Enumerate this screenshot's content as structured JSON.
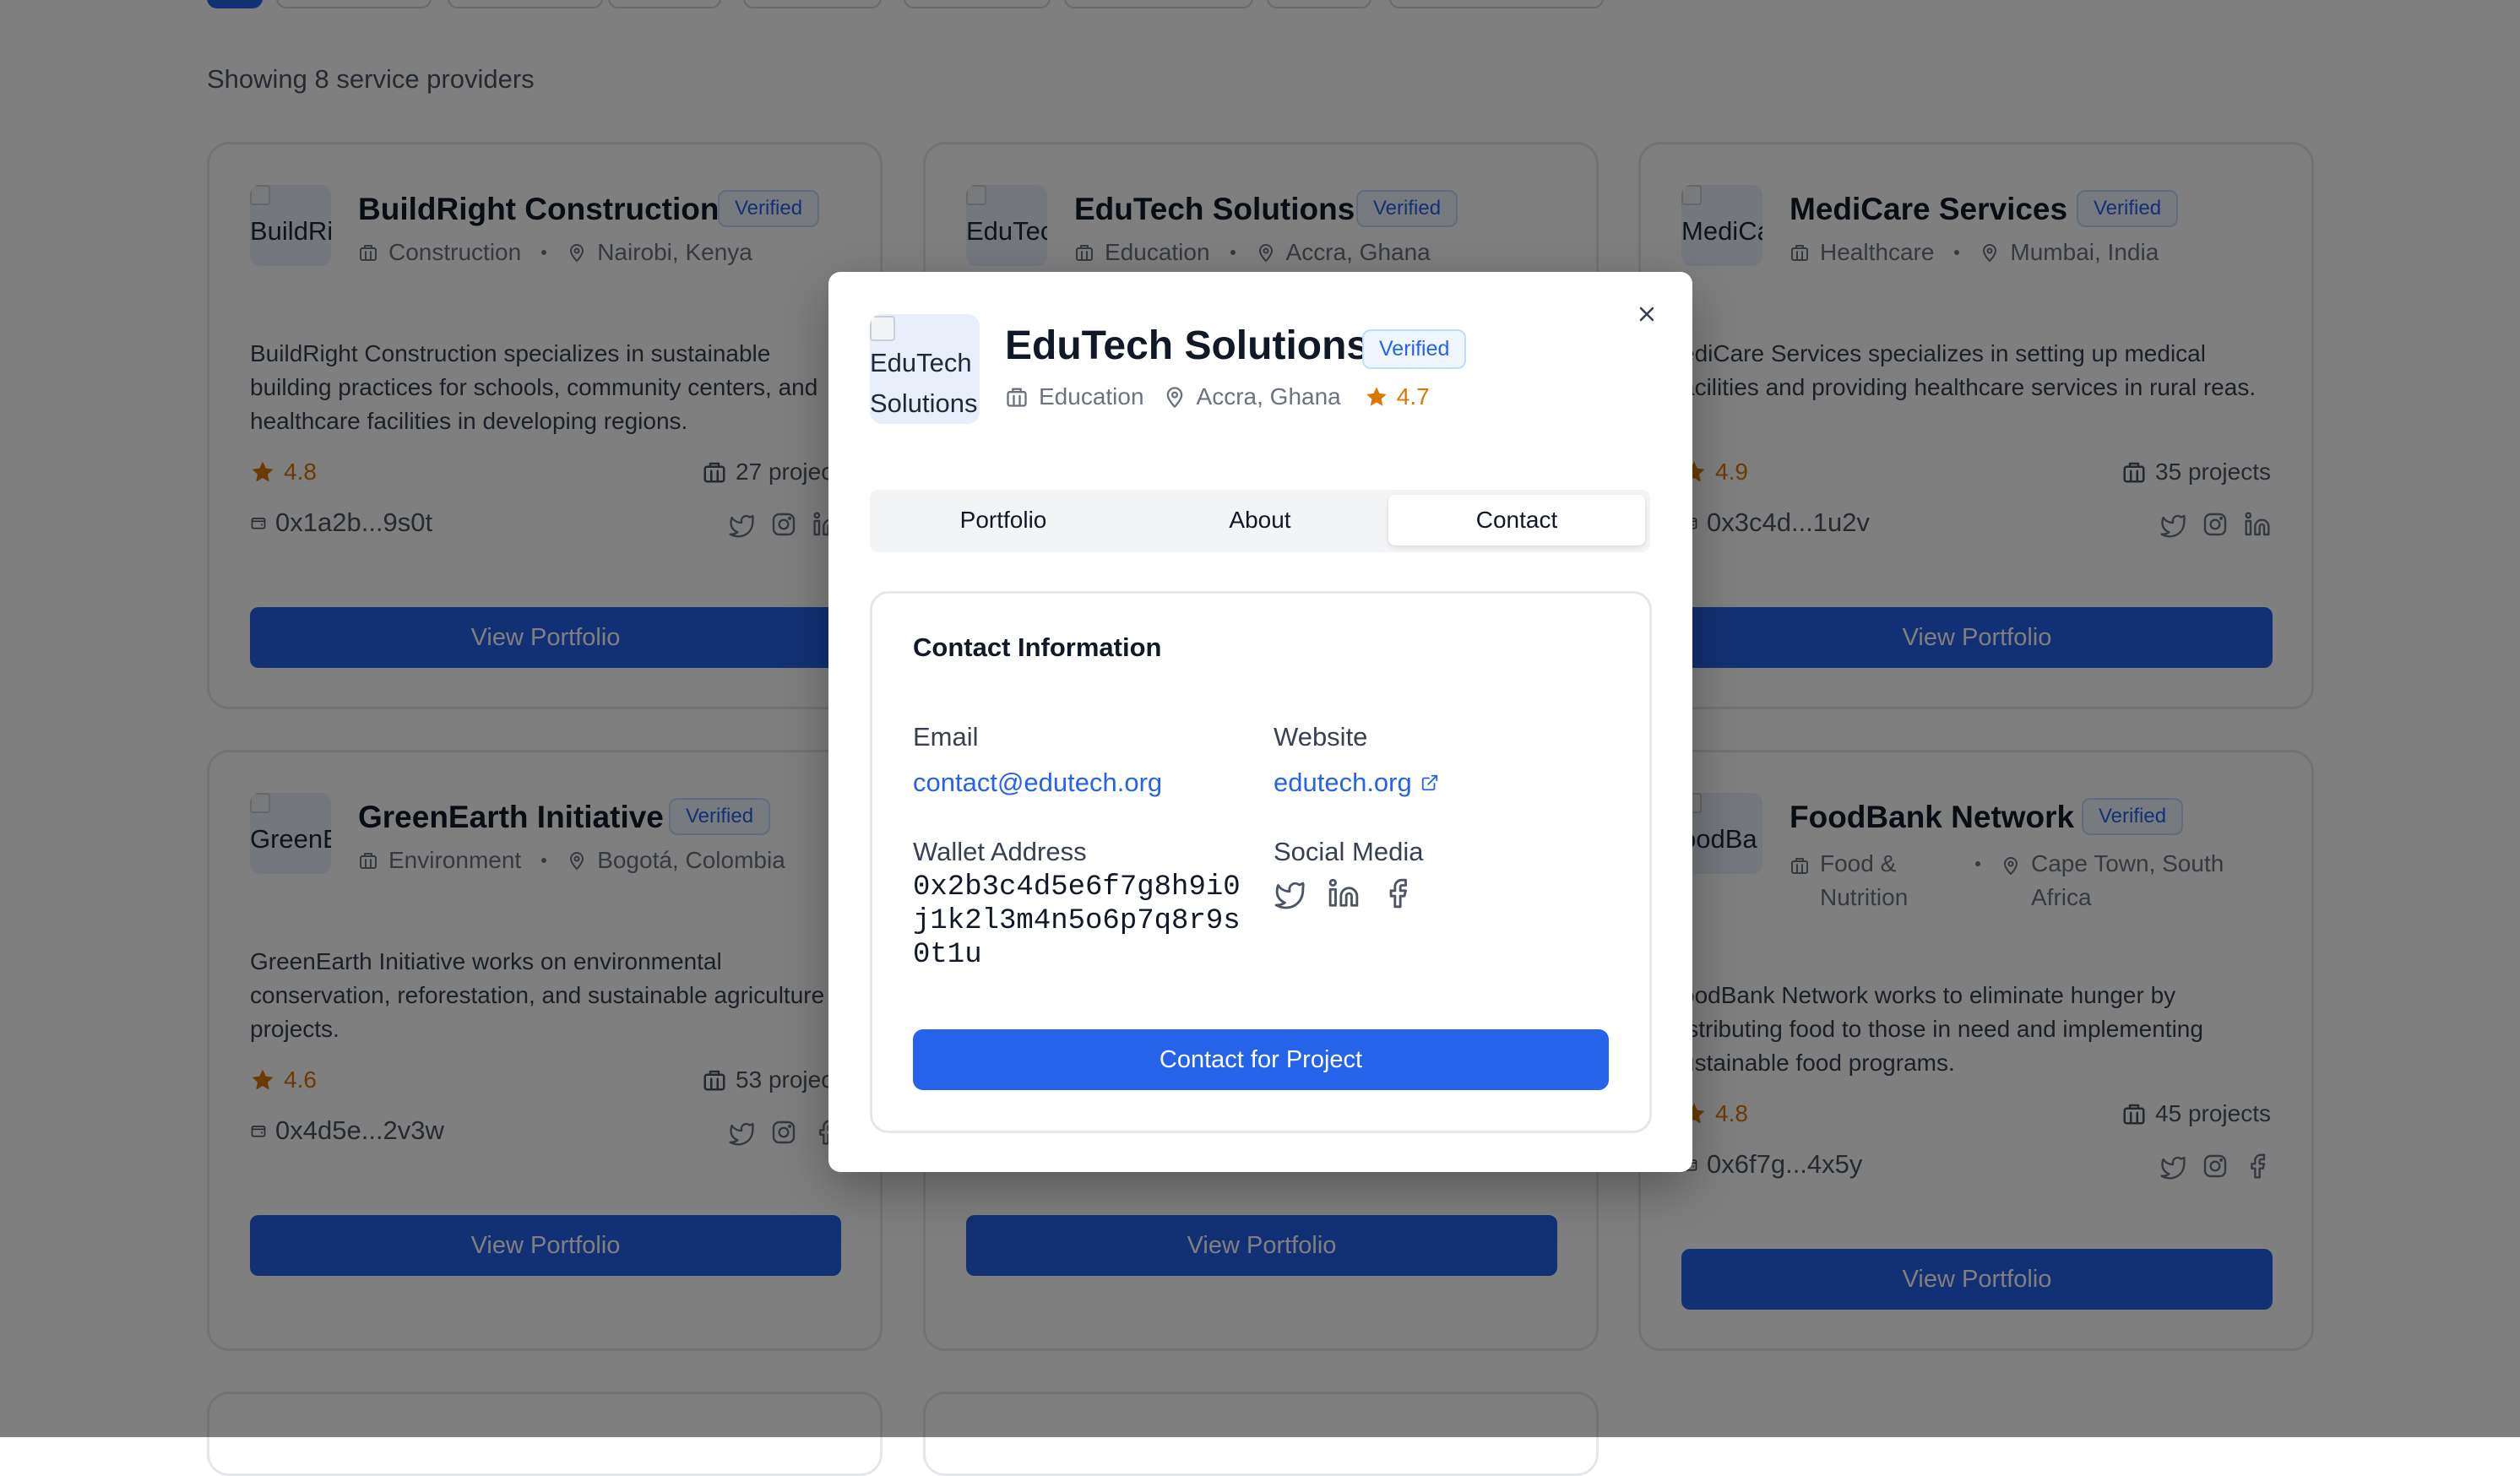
{
  "showing_text": "Showing 8 service providers",
  "colors": {
    "accent": "#2563eb",
    "star": "#d97706",
    "overlay": "rgba(0,0,0,0.5)"
  },
  "cards": [
    {
      "name": "BuildRight Construction",
      "logo_alt": "BuildRi",
      "badge": "Verified",
      "category": "Construction",
      "location": "Nairobi, Kenya",
      "description": "BuildRight Construction specializes in sustainable building practices for schools, community centers, and healthcare facilities in developing regions.",
      "rating": "4.8",
      "projects": "27 project",
      "wallet": "0x1a2b...9s0t",
      "button": "View Portfolio"
    },
    {
      "name": "EduTech Solutions",
      "logo_alt": "EduTec",
      "badge": "Verified",
      "category": "Education",
      "location": "Accra, Ghana"
    },
    {
      "name": "MediCare Services",
      "logo_alt": "MediCa",
      "badge": "Verified",
      "category": "Healthcare",
      "location": "Mumbai, India",
      "description": "MediCare Services specializes in setting up medical facilities and providing healthcare services in rural areas.",
      "description_visible": "ediCare Services specializes in setting up medical acilities and providing healthcare services in rural reas.",
      "rating": "4.9",
      "projects": "35 projects",
      "wallet": "0x3c4d...1u2v",
      "button": "View Portfolio"
    },
    {
      "name": "GreenEarth Initiative",
      "logo_alt": "GreenE",
      "badge": "Verified",
      "category": "Environment",
      "location": "Bogotá, Colombia",
      "description": "GreenEarth Initiative works on environmental conservation, reforestation, and sustainable agriculture projects.",
      "rating": "4.6",
      "projects": "53 project",
      "wallet": "0x4d5e...2v3w",
      "button": "View Portfolio"
    },
    {
      "button": "View Portfolio"
    },
    {
      "name": "FoodBank Network",
      "logo_alt": "oodBa",
      "badge": "Verified",
      "category": "Food & Nutrition",
      "location": "Cape Town, South Africa",
      "description_visible": "oodBank Network works to eliminate hunger by istributing food to those in need and implementing ustainable food programs.",
      "rating": "4.8",
      "projects": "45 projects",
      "wallet": "0x6f7g...4x5y",
      "button": "View Portfolio"
    }
  ],
  "modal": {
    "name": "EduTech Solutions",
    "logo_alt": "EduTech Solutions",
    "badge": "Verified",
    "category": "Education",
    "location": "Accra, Ghana",
    "rating": "4.7",
    "close_icon": "close-icon",
    "tabs": [
      "Portfolio",
      "About",
      "Contact"
    ],
    "active_tab": "Contact",
    "contact": {
      "title": "Contact Information",
      "email_label": "Email",
      "email": "contact@edutech.org",
      "website_label": "Website",
      "website": "edutech.org",
      "wallet_label": "Wallet Address",
      "wallet": "0x2b3c4d5e6f7g8h9i0j1k2l3m4n5o6p7q8r9s0t1u",
      "social_label": "Social Media",
      "socials": [
        "twitter-icon",
        "linkedin-icon",
        "facebook-icon"
      ],
      "button": "Contact for Project"
    }
  }
}
